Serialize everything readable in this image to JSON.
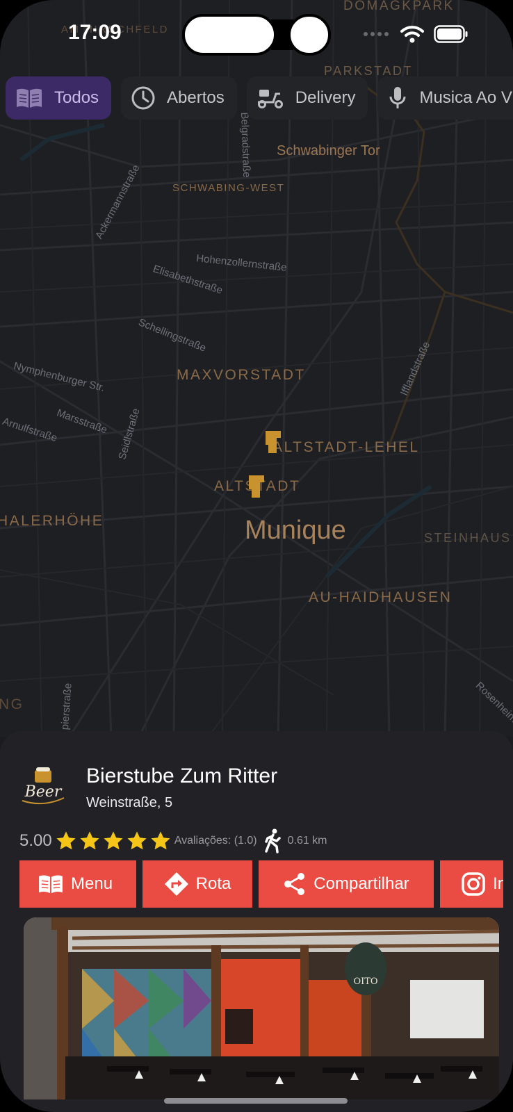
{
  "status_bar": {
    "time": "17:09"
  },
  "filters": [
    {
      "label": "Todos",
      "icon": "book-icon",
      "active": true
    },
    {
      "label": "Abertos",
      "icon": "clock-icon",
      "active": false
    },
    {
      "label": "Delivery",
      "icon": "scooter-icon",
      "active": false
    },
    {
      "label": "Musica Ao V",
      "icon": "microphone-icon",
      "active": false
    }
  ],
  "map": {
    "labels": {
      "domagkpark": "DOMAGKPARK",
      "am_hirschfeld": "AM HIRSCHFELD",
      "parkstadt": "PARKSTADT",
      "schwabinger_tor": "Schwabinger Tor",
      "schwabing_west": "SCHWABING-WEST",
      "belgradstrasse": "Belgradstraße",
      "ackermannstrasse": "Ackermannstraße",
      "hohenzollernstrasse": "Hohenzollernstraße",
      "elisabethstrasse": "Elisabethstraße",
      "schellingstrasse": "Schellingstraße",
      "ifflandstrasse": "Ifflandstraße",
      "nymphenburger": "Nymphenburger Str.",
      "marsstrasse": "Marsstraße",
      "arnulfstrasse": "Arnulfstraße",
      "seidlstrasse": "Seidlstraße",
      "maxvorstadt": "MAXVORSTADT",
      "altstadt_lehel": "ALTSTADT-LEHEL",
      "altstadt": "ALTSTADT",
      "halerhoehe": "HALERHÖHE",
      "munique": "Munique",
      "steinhausen": "STEINHAUS",
      "au_haidhausen": "AU-HAIDHAUSEN",
      "ng": "NG",
      "pierstrasse": "pierstraße",
      "rosenheimer": "Rosenheim"
    }
  },
  "place": {
    "name": "Bierstube Zum Ritter",
    "address": "Weinstraße, 5",
    "rating": "5.00",
    "stars": 5,
    "reviews_label": "Avaliações: (1.0)",
    "distance": "0.61 km",
    "logo_text": "Beer"
  },
  "actions": {
    "menu": "Menu",
    "route": "Rota",
    "share": "Compartilhar",
    "instagram": "In"
  },
  "photo": {
    "sign_text": "OITO"
  },
  "colors": {
    "accent": "#ea4b43",
    "chip_active": "#3b2a66",
    "star": "#f5c518",
    "pin": "#c8932f"
  }
}
